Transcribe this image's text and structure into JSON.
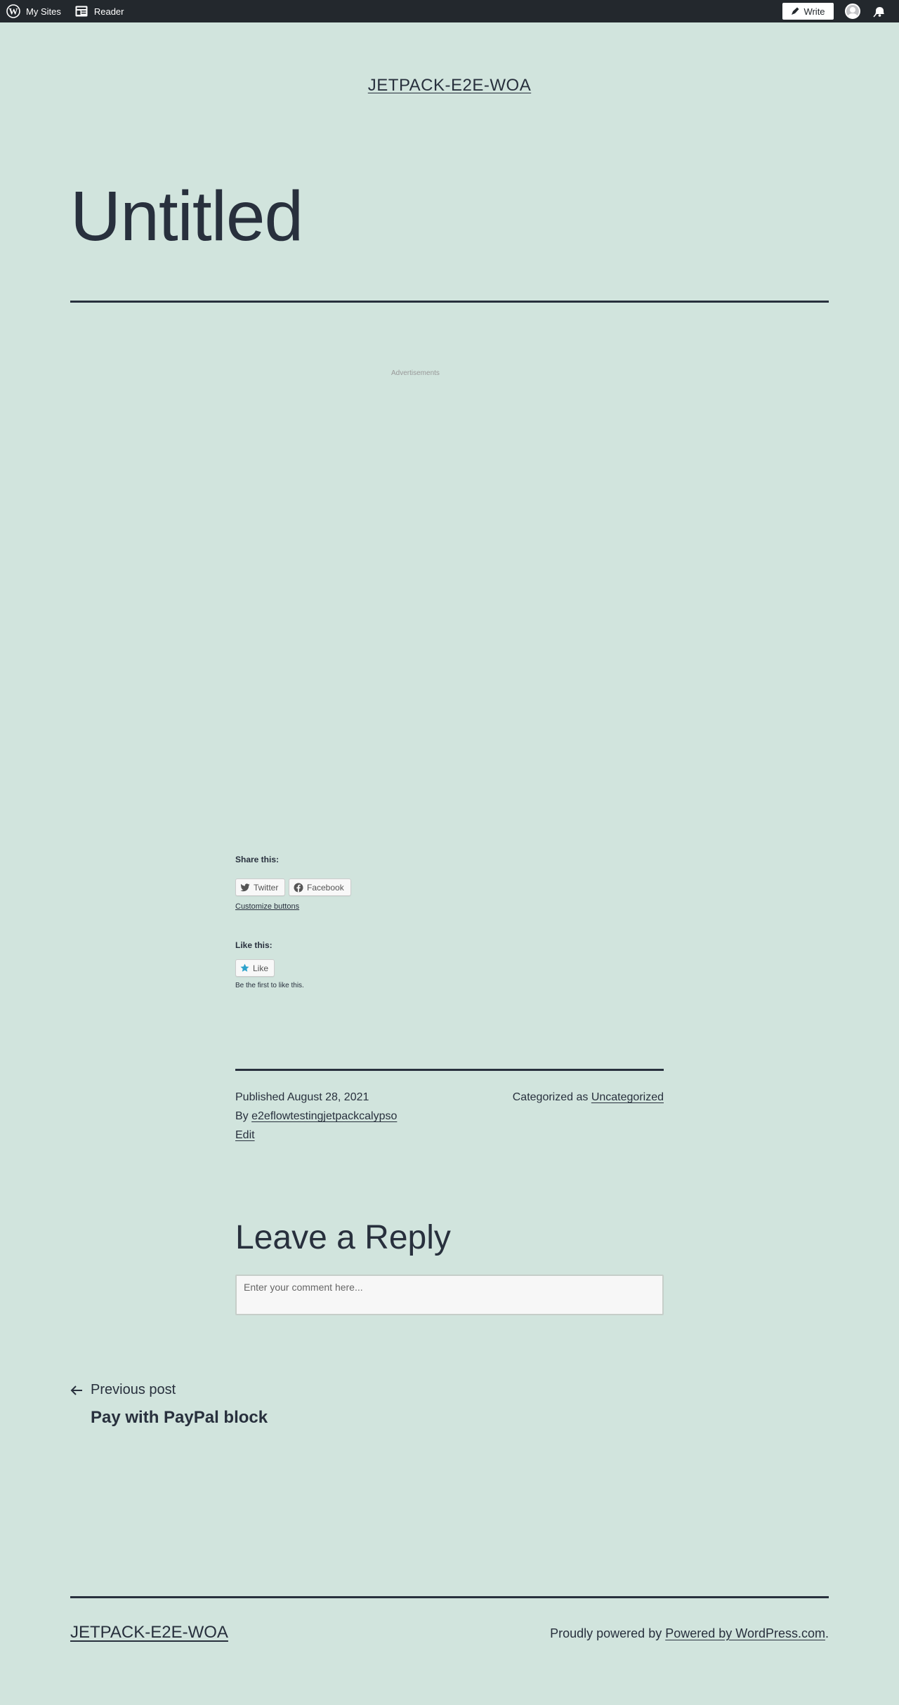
{
  "adminbar": {
    "my_sites": "My Sites",
    "reader": "Reader",
    "write": "Write",
    "icons": [
      "wordpress-logo-icon",
      "reader-icon",
      "pen-icon",
      "avatar",
      "bell-icon"
    ]
  },
  "site": {
    "title": "JETPACK-E2E-WOA"
  },
  "post": {
    "title": "Untitled",
    "ads_label": "Advertisements"
  },
  "sharing": {
    "title": "Share this:",
    "twitter": "Twitter",
    "facebook": "Facebook",
    "customize": "Customize buttons"
  },
  "likes": {
    "title": "Like this:",
    "like": "Like",
    "first": "Be the first to like this."
  },
  "meta": {
    "published_prefix": "Published",
    "published_date": "August 28, 2021",
    "by_prefix": "By",
    "author": "e2eflowtestingjetpackcalypso",
    "edit": "Edit",
    "categorized_prefix": "Categorized as",
    "category": "Uncategorized"
  },
  "comments": {
    "title": "Leave a Reply",
    "placeholder": "Enter your comment here..."
  },
  "navigation": {
    "previous_label": "Previous post",
    "previous_title": "Pay with PayPal block"
  },
  "footer": {
    "site_title": "JETPACK-E2E-WOA",
    "powered_prefix": "Proudly powered by",
    "powered_link": "Powered by WordPress.com",
    "powered_suffix": "."
  },
  "colors": {
    "background": "#d1e4dd",
    "text": "#28303d",
    "adminbar": "#23282d"
  }
}
